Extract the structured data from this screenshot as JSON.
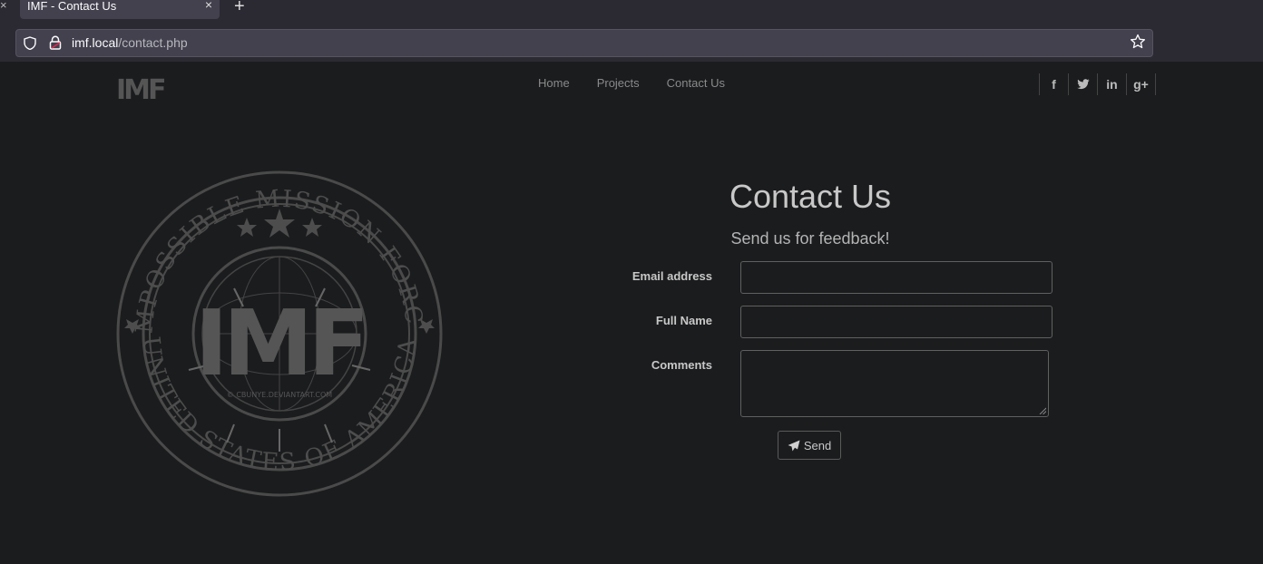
{
  "browser": {
    "tab_title": "IMF - Contact Us",
    "tab_close": "×",
    "new_tab": "+",
    "url_host": "imf.local",
    "url_path": "/contact.php"
  },
  "site": {
    "logo_text": "IMF",
    "nav": [
      {
        "label": "Home"
      },
      {
        "label": "Projects"
      },
      {
        "label": "Contact Us"
      }
    ],
    "social": [
      {
        "icon": "facebook-icon",
        "glyph": "f"
      },
      {
        "icon": "twitter-icon",
        "glyph": "t"
      },
      {
        "icon": "linkedin-icon",
        "glyph": "in"
      },
      {
        "icon": "google-plus-icon",
        "glyph": "g+"
      }
    ],
    "emblem": {
      "top_text": "IMPOSSIBLE MISSION FORCE",
      "bottom_text": "UNITED STATES OF AMERICA",
      "center_text": "IMF",
      "watermark": "© CBUNYE.DEVIANTART.COM"
    }
  },
  "contact": {
    "title": "Contact Us",
    "subtitle": "Send us for feedback!",
    "email_label": "Email address",
    "email_value": "",
    "name_label": "Full Name",
    "name_value": "",
    "comments_label": "Comments",
    "comments_value": "",
    "send_label": "Send"
  },
  "colors": {
    "background": "#1b1c1e",
    "chrome": "#2b2a33",
    "urlbar": "#42414d"
  }
}
